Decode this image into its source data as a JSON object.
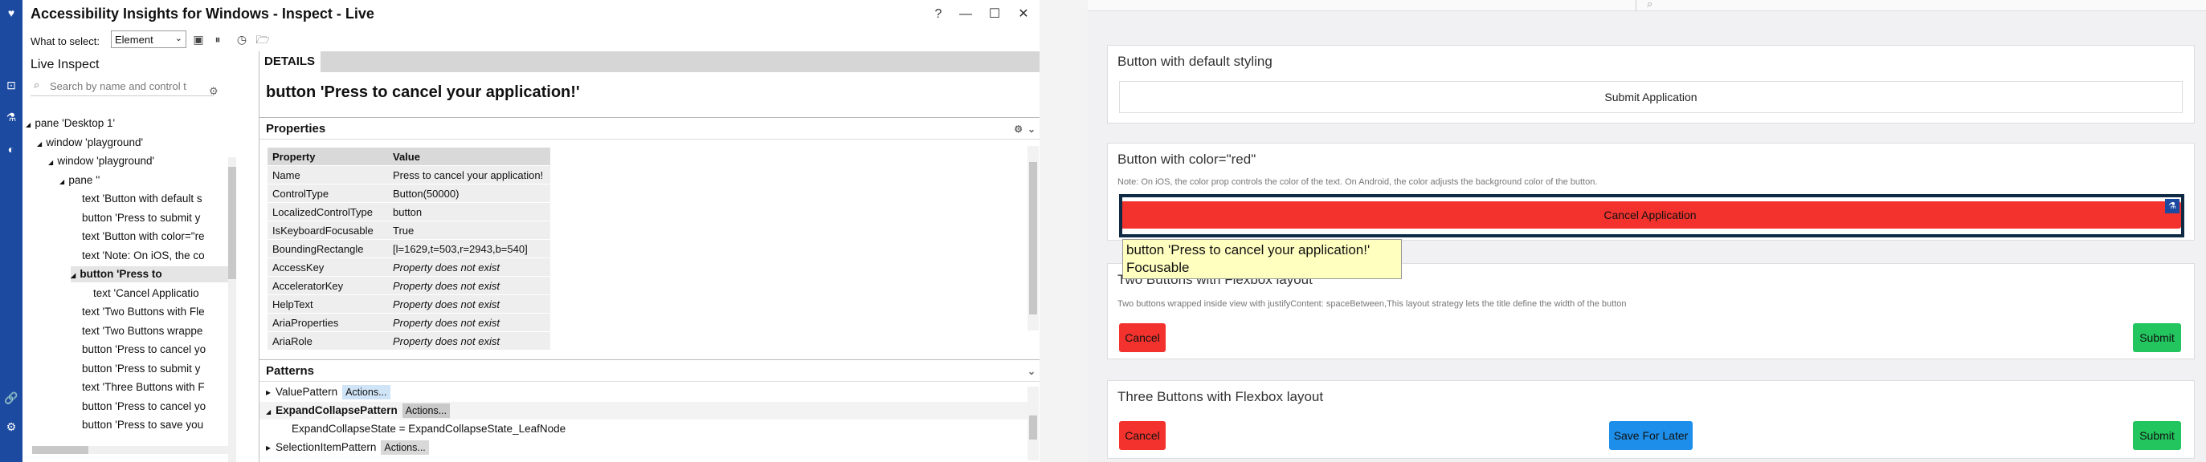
{
  "window": {
    "title": "Accessibility Insights for Windows - Inspect - Live",
    "help_icon": "?",
    "minimize_icon": "—",
    "maximize_icon": "☐",
    "close_icon": "✕"
  },
  "toolbar": {
    "what_to_select_label": "What to select:",
    "select_value": "Element"
  },
  "live_inspect": {
    "title": "Live Inspect",
    "search_placeholder": "Search by name and control t",
    "tree": [
      {
        "label": "pane 'Desktop 1'",
        "level": 0,
        "expanded": true,
        "selected": false
      },
      {
        "label": "window 'playground'",
        "level": 1,
        "expanded": true,
        "selected": false
      },
      {
        "label": "window 'playground'",
        "level": 2,
        "expanded": true,
        "selected": false
      },
      {
        "label": "pane ''",
        "level": 3,
        "expanded": true,
        "selected": false
      },
      {
        "label": "text 'Button with default s",
        "level": 4,
        "expanded": null,
        "selected": false
      },
      {
        "label": "button 'Press to submit y",
        "level": 4,
        "expanded": null,
        "selected": false
      },
      {
        "label": "text 'Button with color=\"re",
        "level": 4,
        "expanded": null,
        "selected": false
      },
      {
        "label": "text 'Note: On iOS, the co",
        "level": 4,
        "expanded": null,
        "selected": false
      },
      {
        "label": "button 'Press to",
        "level": 4,
        "expanded": true,
        "selected": true
      },
      {
        "label": "text 'Cancel Applicatio",
        "level": 5,
        "expanded": null,
        "selected": false
      },
      {
        "label": "text 'Two Buttons with Fle",
        "level": 4,
        "expanded": null,
        "selected": false
      },
      {
        "label": "text 'Two Buttons wrappe",
        "level": 4,
        "expanded": null,
        "selected": false
      },
      {
        "label": "button 'Press to cancel yo",
        "level": 4,
        "expanded": null,
        "selected": false
      },
      {
        "label": "button 'Press to submit y",
        "level": 4,
        "expanded": null,
        "selected": false
      },
      {
        "label": "text 'Three Buttons with F",
        "level": 4,
        "expanded": null,
        "selected": false
      },
      {
        "label": "button 'Press to cancel yo",
        "level": 4,
        "expanded": null,
        "selected": false
      },
      {
        "label": "button 'Press to save you",
        "level": 4,
        "expanded": null,
        "selected": false
      }
    ]
  },
  "details": {
    "tab_label": "DETAILS",
    "element_heading": "button 'Press to cancel your application!'",
    "properties_title": "Properties",
    "property_header": "Property",
    "value_header": "Value",
    "properties": [
      {
        "name": "Name",
        "value": "Press to cancel your application!",
        "missing": false
      },
      {
        "name": "ControlType",
        "value": "Button(50000)",
        "missing": false
      },
      {
        "name": "LocalizedControlType",
        "value": "button",
        "missing": false
      },
      {
        "name": "IsKeyboardFocusable",
        "value": "True",
        "missing": false
      },
      {
        "name": "BoundingRectangle",
        "value": "[l=1629,t=503,r=2943,b=540]",
        "missing": false
      },
      {
        "name": "AccessKey",
        "value": "Property does not exist",
        "missing": true
      },
      {
        "name": "AcceleratorKey",
        "value": "Property does not exist",
        "missing": true
      },
      {
        "name": "HelpText",
        "value": "Property does not exist",
        "missing": true
      },
      {
        "name": "AriaProperties",
        "value": "Property does not exist",
        "missing": true
      },
      {
        "name": "AriaRole",
        "value": "Property does not exist",
        "missing": true
      }
    ],
    "patterns_title": "Patterns",
    "patterns": [
      {
        "label": "ValuePattern",
        "action": "Actions...",
        "expanded": false,
        "bold": false
      },
      {
        "label": "ExpandCollapsePattern",
        "action": "Actions...",
        "expanded": true,
        "bold": true
      },
      {
        "label": "ExpandCollapseState = ExpandCollapseState_LeafNode",
        "action": null,
        "expanded": null,
        "bold": false
      },
      {
        "label": "SelectionItemPattern",
        "action": "Actions...",
        "expanded": false,
        "bold": false
      }
    ]
  },
  "playground": {
    "card1": {
      "title": "Button with default styling",
      "button": "Submit Application"
    },
    "card2": {
      "title": "Button with color=\"red\"",
      "note": "Note: On iOS, the color prop controls the color of the text. On Android, the color adjusts the background color of the button.",
      "button": "Cancel Application"
    },
    "tooltip_line1": "button 'Press to cancel your application!'",
    "tooltip_line2": "Focusable",
    "card3": {
      "title": "Two Buttons with Flexbox layout",
      "note": "Two buttons wrapped inside view with justifyContent: spaceBetween,This layout strategy lets the title define the width of the button",
      "cancel": "Cancel",
      "submit": "Submit"
    },
    "card4": {
      "title": "Three Buttons with Flexbox layout",
      "cancel": "Cancel",
      "save": "Save For Later",
      "submit": "Submit"
    }
  },
  "colors": {
    "rail": "#1c4aa0",
    "red_button": "#f3322d",
    "green_button": "#22c55e",
    "blue_button": "#1d8fea",
    "highlight_border": "#0f2a44",
    "tooltip_bg": "#ffffc0"
  }
}
